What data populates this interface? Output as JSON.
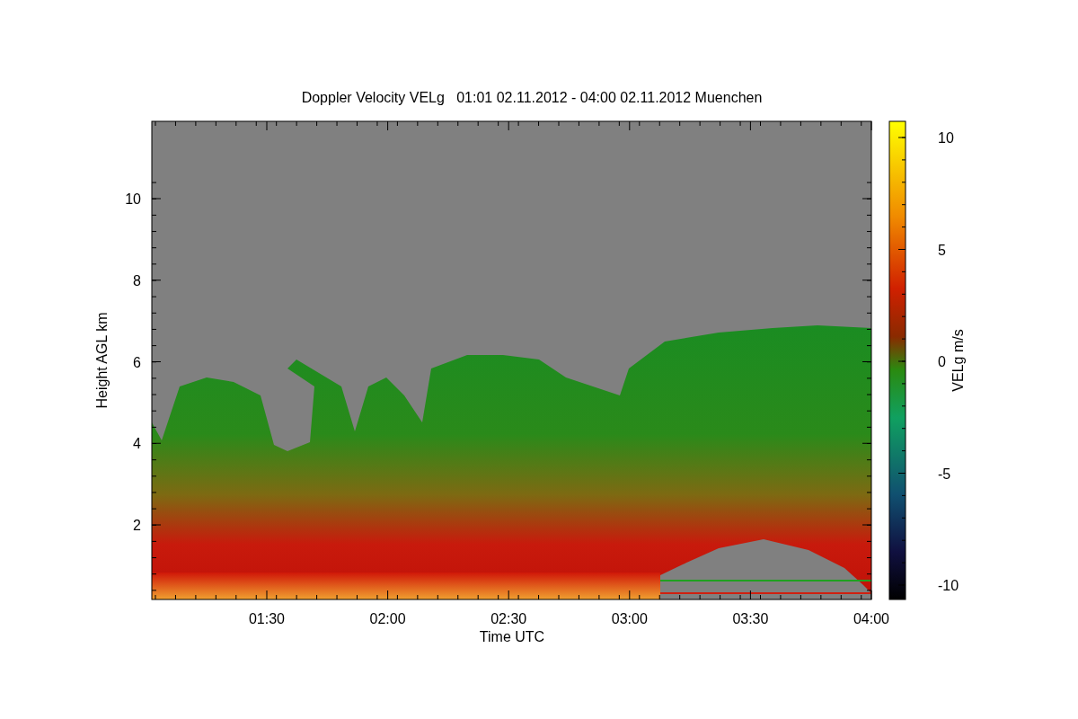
{
  "title": "Doppler Velocity VELg   01:01 02.11.2012 - 04:00 02.11.2012 Muenchen",
  "y_axis": {
    "label": "Height AGL km",
    "ticks": [
      "10",
      "8",
      "6",
      "4",
      "2"
    ]
  },
  "x_axis": {
    "label": "Time UTC",
    "ticks": [
      "01:30",
      "02:00",
      "02:30",
      "03:00",
      "03:30",
      "04:00"
    ]
  },
  "colorbar": {
    "label": "VELg m/s",
    "ticks": [
      "10",
      "5",
      "0",
      "-5",
      "-10"
    ]
  }
}
